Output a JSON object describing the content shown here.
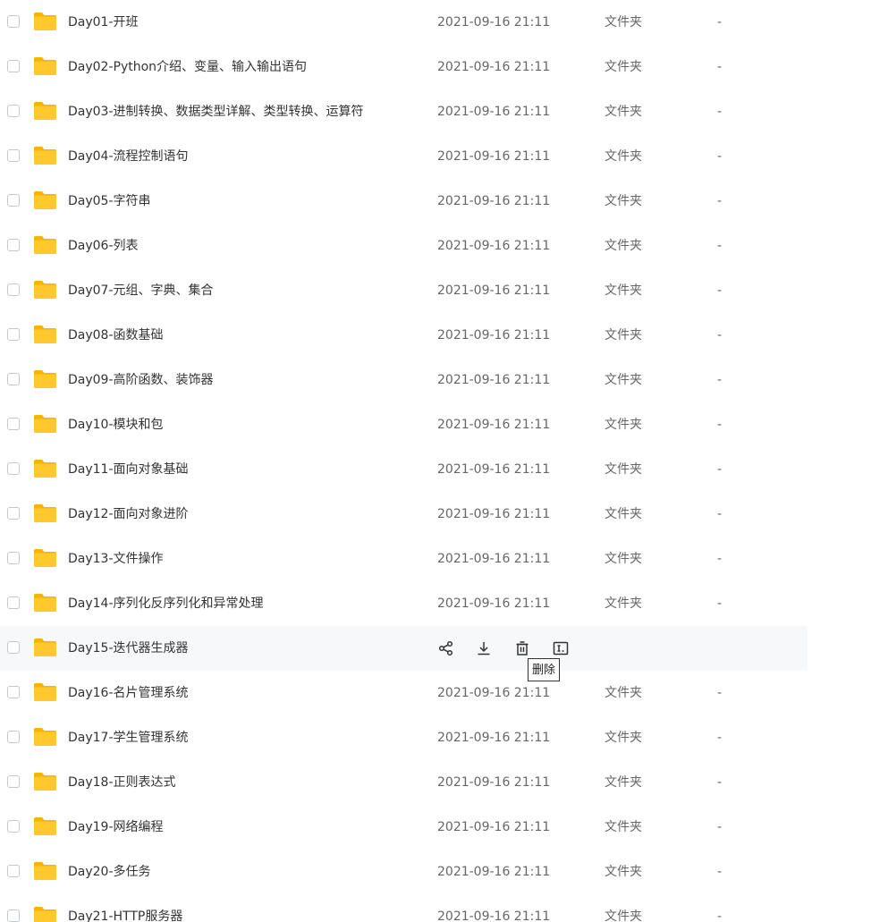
{
  "colors": {
    "folder": "#ffc82c",
    "folder_tab": "#f5b400",
    "hover_row": "#f7f8fa",
    "text_primary": "#333333",
    "text_secondary": "#666666"
  },
  "icons": {
    "folder": "folder-icon",
    "share": "share-icon",
    "download": "download-icon",
    "delete": "delete-icon",
    "rename": "rename-icon"
  },
  "rows": [
    {
      "name": "Day01-开班",
      "date": "2021-09-16 21:11",
      "type": "文件夹",
      "size": "-"
    },
    {
      "name": "Day02-Python介绍、变量、输入输出语句",
      "date": "2021-09-16 21:11",
      "type": "文件夹",
      "size": "-"
    },
    {
      "name": "Day03-进制转换、数据类型详解、类型转换、运算符",
      "date": "2021-09-16 21:11",
      "type": "文件夹",
      "size": "-"
    },
    {
      "name": "Day04-流程控制语句",
      "date": "2021-09-16 21:11",
      "type": "文件夹",
      "size": "-"
    },
    {
      "name": "Day05-字符串",
      "date": "2021-09-16 21:11",
      "type": "文件夹",
      "size": "-"
    },
    {
      "name": "Day06-列表",
      "date": "2021-09-16 21:11",
      "type": "文件夹",
      "size": "-"
    },
    {
      "name": "Day07-元组、字典、集合",
      "date": "2021-09-16 21:11",
      "type": "文件夹",
      "size": "-"
    },
    {
      "name": "Day08-函数基础",
      "date": "2021-09-16 21:11",
      "type": "文件夹",
      "size": "-"
    },
    {
      "name": "Day09-高阶函数、装饰器",
      "date": "2021-09-16 21:11",
      "type": "文件夹",
      "size": "-"
    },
    {
      "name": "Day10-模块和包",
      "date": "2021-09-16 21:11",
      "type": "文件夹",
      "size": "-"
    },
    {
      "name": "Day11-面向对象基础",
      "date": "2021-09-16 21:11",
      "type": "文件夹",
      "size": "-"
    },
    {
      "name": "Day12-面向对象进阶",
      "date": "2021-09-16 21:11",
      "type": "文件夹",
      "size": "-"
    },
    {
      "name": "Day13-文件操作",
      "date": "2021-09-16 21:11",
      "type": "文件夹",
      "size": "-"
    },
    {
      "name": "Day14-序列化反序列化和异常处理",
      "date": "2021-09-16 21:11",
      "type": "文件夹",
      "size": "-"
    },
    {
      "name": "Day15-迭代器生成器",
      "hovered": true
    },
    {
      "name": "Day16-名片管理系统",
      "date": "2021-09-16 21:11",
      "type": "文件夹",
      "size": "-"
    },
    {
      "name": "Day17-学生管理系统",
      "date": "2021-09-16 21:11",
      "type": "文件夹",
      "size": "-"
    },
    {
      "name": "Day18-正则表达式",
      "date": "2021-09-16 21:11",
      "type": "文件夹",
      "size": "-"
    },
    {
      "name": "Day19-网络编程",
      "date": "2021-09-16 21:11",
      "type": "文件夹",
      "size": "-"
    },
    {
      "name": "Day20-多任务",
      "date": "2021-09-16 21:11",
      "type": "文件夹",
      "size": "-"
    },
    {
      "name": "Day21-HTTP服务器",
      "date": "2021-09-16 21:11",
      "type": "文件夹",
      "size": "-"
    }
  ],
  "tooltip": {
    "text": "删除"
  }
}
